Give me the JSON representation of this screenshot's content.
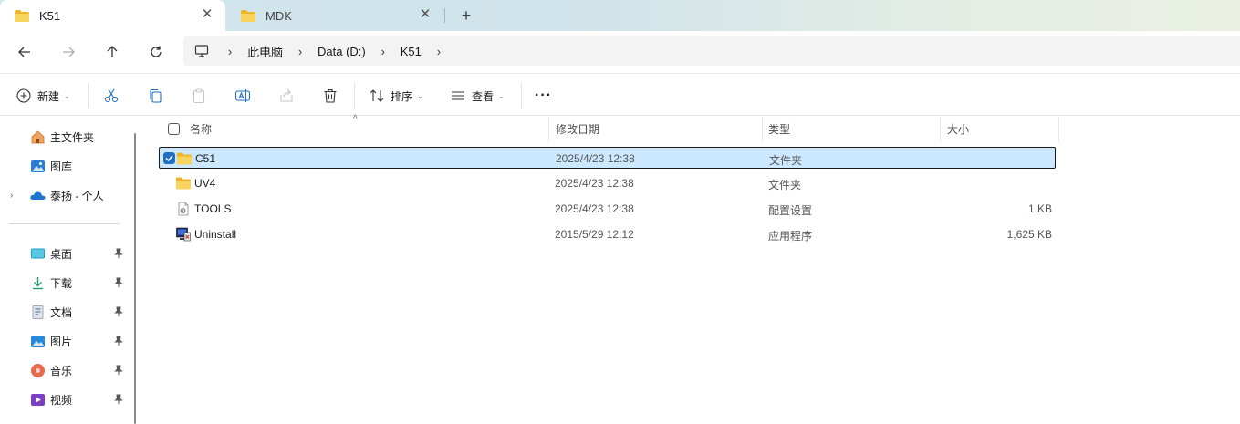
{
  "tabs": [
    {
      "label": "K51",
      "icon": "folder-icon",
      "active": true
    },
    {
      "label": "MDK",
      "icon": "folder-icon",
      "active": false
    }
  ],
  "new_tab_label": "+",
  "address": {
    "crumbs": [
      "此电脑",
      "Data (D:)",
      "K51"
    ],
    "root_icon": "monitor-icon"
  },
  "commands": {
    "new_label": "新建",
    "sort_label": "排序",
    "view_label": "查看",
    "more_label": "···"
  },
  "sidebar": {
    "quick": [
      {
        "label": "主文件夹",
        "icon": "home-icon"
      },
      {
        "label": "图库",
        "icon": "gallery-icon"
      },
      {
        "label": "泰扬 - 个人",
        "icon": "onedrive-cloud-icon"
      }
    ],
    "pinned": [
      {
        "label": "桌面",
        "icon": "desktop-icon"
      },
      {
        "label": "下载",
        "icon": "download-icon"
      },
      {
        "label": "文档",
        "icon": "documents-icon"
      },
      {
        "label": "图片",
        "icon": "pictures-icon"
      },
      {
        "label": "音乐",
        "icon": "music-icon"
      },
      {
        "label": "视频",
        "icon": "videos-icon"
      }
    ]
  },
  "columns": {
    "name": "名称",
    "date": "修改日期",
    "type": "类型",
    "size": "大小"
  },
  "files": [
    {
      "name": "C51",
      "date": "2025/4/23 12:38",
      "type": "文件夹",
      "size": "",
      "icon": "folder-icon",
      "selected": true
    },
    {
      "name": "UV4",
      "date": "2025/4/23 12:38",
      "type": "文件夹",
      "size": "",
      "icon": "folder-icon",
      "selected": false
    },
    {
      "name": "TOOLS",
      "date": "2025/4/23 12:38",
      "type": "配置设置",
      "size": "1 KB",
      "icon": "config-file-icon",
      "selected": false
    },
    {
      "name": "Uninstall",
      "date": "2015/5/29 12:12",
      "type": "应用程序",
      "size": "1,625 KB",
      "icon": "application-icon",
      "selected": false
    }
  ],
  "colors": {
    "selection_bg": "#cce8ff",
    "accent": "#1f6fc4",
    "folder_yellow": "#f7c948"
  }
}
